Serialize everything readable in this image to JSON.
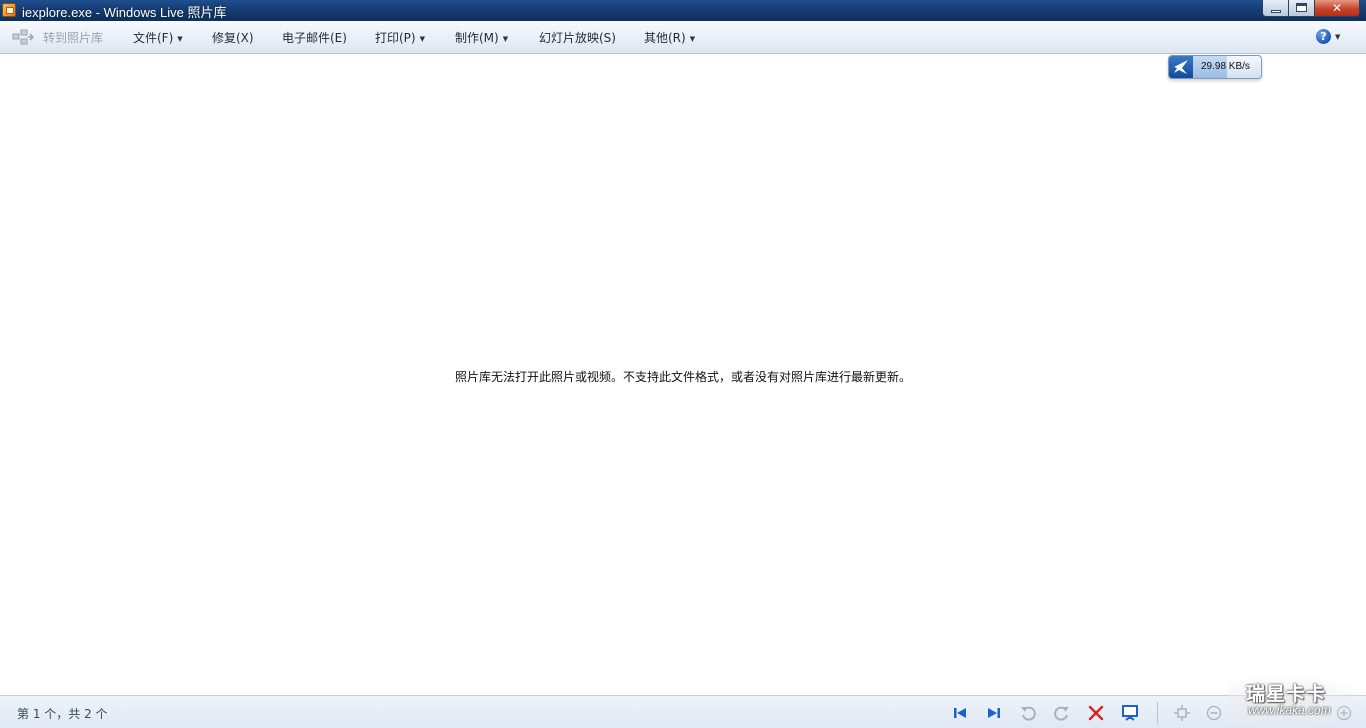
{
  "window": {
    "title": "iexplore.exe - Windows Live 照片库",
    "buttons": {
      "minimize": "",
      "maximize": "",
      "close": "✕"
    }
  },
  "menubar": {
    "goto_gallery": "转到照片库",
    "file": "文件(F)",
    "fix": "修复(X)",
    "email": "电子邮件(E)",
    "print": "打印(P)",
    "make": "制作(M)",
    "slideshow": "幻灯片放映(S)",
    "extras": "其他(R)",
    "help": "?"
  },
  "speed_widget": {
    "value": "29.98 KB/s"
  },
  "message": "照片库无法打开此照片或视频。不支持此文件格式，或者没有对照片库进行最新更新。",
  "statusbar": {
    "page_count": "第 1 个，共 2 个",
    "icons": [
      "first-icon",
      "next-icon",
      "rotate-left-icon",
      "rotate-right-icon",
      "delete-icon",
      "slideshow-icon",
      "actual-size-icon",
      "zoom-out-icon",
      "zoom-in-icon"
    ]
  },
  "watermark": {
    "brand": "瑞星卡卡",
    "url": "www.ikaka.com"
  },
  "colors": {
    "titlebar": "#163e74",
    "menubar": "#e8eef7",
    "nav_blue": "#1b63c6",
    "delete_red": "#d42020"
  }
}
